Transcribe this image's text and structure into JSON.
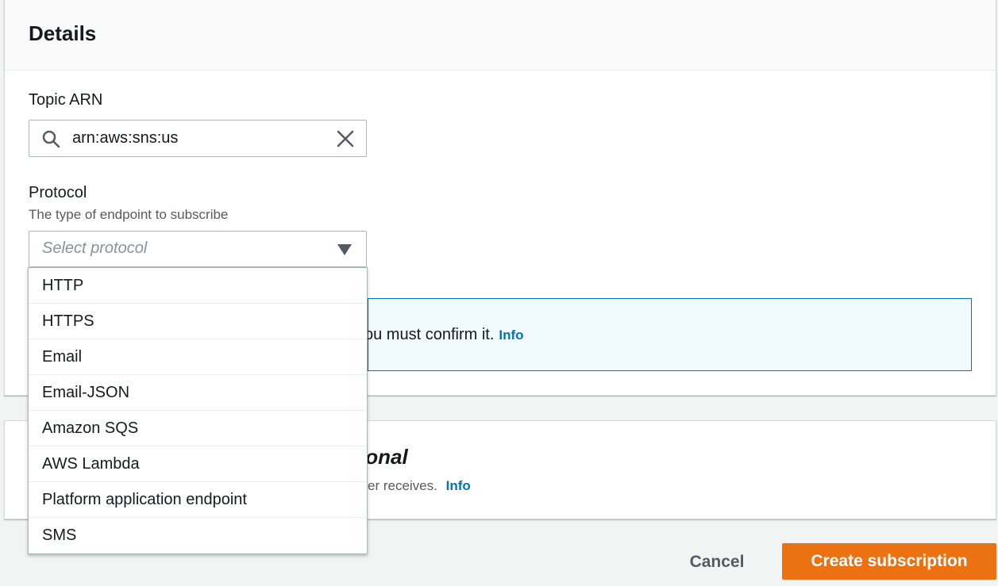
{
  "details": {
    "title": "Details",
    "topic_arn": {
      "label": "Topic ARN",
      "value": "arn:aws:sns:us"
    },
    "protocol": {
      "label": "Protocol",
      "description": "The type of endpoint to subscribe",
      "placeholder": "Select protocol",
      "options": [
        "HTTP",
        "HTTPS",
        "Email",
        "Email-JSON",
        "Amazon SQS",
        "AWS Lambda",
        "Platform application endpoint",
        "SMS"
      ]
    },
    "alert": {
      "text": "ou must confirm it.",
      "info_link": "Info"
    }
  },
  "second_section": {
    "title_fragment": "ional",
    "description_fragment": "er receives.",
    "info_link": "Info"
  },
  "actions": {
    "cancel_label": "Cancel",
    "create_label": "Create subscription"
  },
  "colors": {
    "primary": "#ec7211",
    "link": "#0073bb",
    "alert_border": "#0073bb",
    "alert_bg": "#f1faff"
  },
  "icons": {
    "search": "search-icon",
    "clear": "close-icon",
    "dropdown": "caret-down-icon"
  }
}
